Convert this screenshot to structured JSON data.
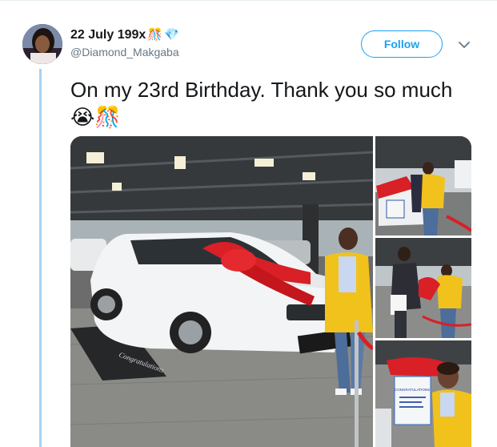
{
  "tweet": {
    "display_name": "22 July 199x",
    "name_emojis": [
      "🎊",
      "💎"
    ],
    "handle": "@Diamond_Makgaba",
    "follow_label": "Follow",
    "text": "On my 23rd Birthday. Thank you so much😭🎊"
  },
  "media": {
    "plate_text": "Congratulations",
    "sign_text": "CONGRATULATIONS"
  },
  "colors": {
    "accent": "#1da1f2",
    "thread": "#a3d3f5",
    "handle_gray": "#657786",
    "text": "#14171a"
  },
  "icons": [
    "chevron-down-icon"
  ]
}
